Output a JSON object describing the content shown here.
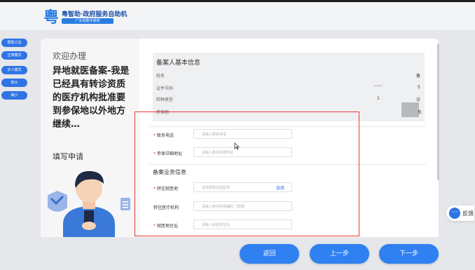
{
  "header": {
    "brand_title": "粤智助·政府服务自助机",
    "brand_sub": "广东省数字政府",
    "colors": {
      "brand": "#1a4fa8",
      "accent": "#2f74e4"
    }
  },
  "sidebar": {
    "buttons": [
      "帮助工具",
      "正常模式",
      "长人模式",
      "放大",
      "缩小"
    ]
  },
  "left_panel": {
    "welcome": "欢迎办理",
    "headline": "异地就医备案-我是已经具有转诊资质的医疗机构批准要到参保地以外地方继续…",
    "step": "填写申请",
    "illustration_icon": "user-with-phone-icon"
  },
  "info": {
    "title": "备案人基本信息",
    "rows": [
      {
        "label": "姓名",
        "value": "备"
      },
      {
        "label": "证件号码",
        "value": "5"
      },
      {
        "label": "险种类型",
        "value": "诊",
        "extra": "1"
      },
      {
        "label": "参保地",
        "value": "东"
      }
    ],
    "id_masked": "*****"
  },
  "form": {
    "fields": [
      {
        "label": "联系电话",
        "required": true,
        "placeholder": "请输入联系电话"
      },
      {
        "label": "参保详细地址",
        "required": true,
        "placeholder": "请输入参保详细地址"
      }
    ],
    "section_title": "备案业务信息",
    "business_fields": [
      {
        "label": "转往就医地",
        "required": true,
        "placeholder": "请选择转往就医地",
        "action": "选择"
      },
      {
        "label": "转往医疗机构",
        "required": false,
        "placeholder": "请输入转往机构编码（选填）"
      },
      {
        "label": "就医地住址",
        "required": true,
        "placeholder": "请输入就医地住址"
      }
    ]
  },
  "feedback": {
    "label": "反馈"
  },
  "nav": {
    "back": "返回",
    "prev": "上一步",
    "next": "下一步"
  }
}
